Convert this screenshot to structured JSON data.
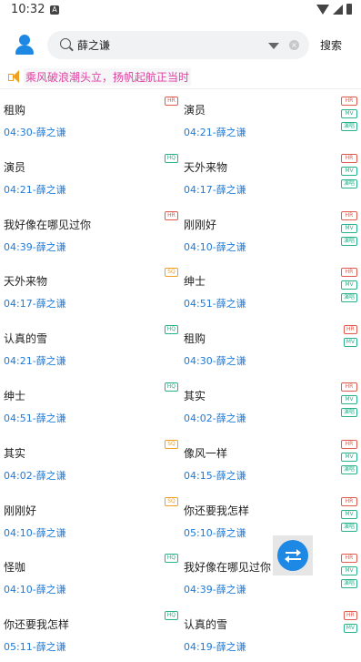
{
  "status_bar": {
    "time": "10:32",
    "notification": "A"
  },
  "search": {
    "value": "薛之谦",
    "button_label": "搜索",
    "clear_symbol": "×"
  },
  "marquee": {
    "text": "乘风破浪潮头立，扬帆起航正当时"
  },
  "songs": [
    {
      "title": "租购",
      "duration": "04:30",
      "artist": "薛之谦",
      "badges": [
        "HR"
      ]
    },
    {
      "title": "演员",
      "duration": "04:21",
      "artist": "薛之谦",
      "badges": [
        "HR",
        "MV",
        "演唱"
      ]
    },
    {
      "title": "演员",
      "duration": "04:21",
      "artist": "薛之谦",
      "badges": [
        "HQ"
      ]
    },
    {
      "title": "天外来物",
      "duration": "04:17",
      "artist": "薛之谦",
      "badges": [
        "HR",
        "MV",
        "演唱"
      ]
    },
    {
      "title": "我好像在哪见过你",
      "duration": "04:39",
      "artist": "薛之谦",
      "badges": [
        "HR"
      ]
    },
    {
      "title": "刚刚好",
      "duration": "04:10",
      "artist": "薛之谦",
      "badges": [
        "HR",
        "MV",
        "演唱"
      ]
    },
    {
      "title": "天外来物",
      "duration": "04:17",
      "artist": "薛之谦",
      "badges": [
        "SQ"
      ]
    },
    {
      "title": "绅士",
      "duration": "04:51",
      "artist": "薛之谦",
      "badges": [
        "HR",
        "MV",
        "演唱"
      ]
    },
    {
      "title": "认真的雪",
      "duration": "04:21",
      "artist": "薛之谦",
      "badges": [
        "HQ"
      ]
    },
    {
      "title": "租购",
      "duration": "04:30",
      "artist": "薛之谦",
      "badges": [
        "HR",
        "MV"
      ]
    },
    {
      "title": "绅士",
      "duration": "04:51",
      "artist": "薛之谦",
      "badges": [
        "HQ"
      ]
    },
    {
      "title": "其实",
      "duration": "04:02",
      "artist": "薛之谦",
      "badges": [
        "HR",
        "MV",
        "演唱"
      ]
    },
    {
      "title": "其实",
      "duration": "04:02",
      "artist": "薛之谦",
      "badges": [
        "SQ"
      ]
    },
    {
      "title": "像风一样",
      "duration": "04:15",
      "artist": "薛之谦",
      "badges": [
        "HR",
        "MV",
        "演唱"
      ]
    },
    {
      "title": "刚刚好",
      "duration": "04:10",
      "artist": "薛之谦",
      "badges": [
        "SQ"
      ]
    },
    {
      "title": "你还要我怎样",
      "duration": "05:10",
      "artist": "薛之谦",
      "badges": [
        "HR",
        "MV",
        "演唱"
      ]
    },
    {
      "title": "怪咖",
      "duration": "04:10",
      "artist": "薛之谦",
      "badges": [
        "HQ"
      ]
    },
    {
      "title": "我好像在哪见过你",
      "duration": "04:39",
      "artist": "薛之谦",
      "badges": [
        "HR",
        "MV",
        "演唱"
      ]
    },
    {
      "title": "你还要我怎样",
      "duration": "05:11",
      "artist": "薛之谦",
      "badges": [
        "HQ"
      ]
    },
    {
      "title": "认真的雪",
      "duration": "04:19",
      "artist": "薛之谦",
      "badges": [
        "HR",
        "MV"
      ]
    }
  ],
  "colors": {
    "accent": "#1e88e5",
    "meta_text": "#1e7ad8",
    "marquee_text": "#e040a0",
    "badge_hr": "#e05a4e",
    "badge_hq": "#27b28a",
    "badge_sq": "#f0a020"
  },
  "icons": {
    "fab": "swap-arrows-icon",
    "avatar": "user-icon",
    "search": "search-icon"
  }
}
